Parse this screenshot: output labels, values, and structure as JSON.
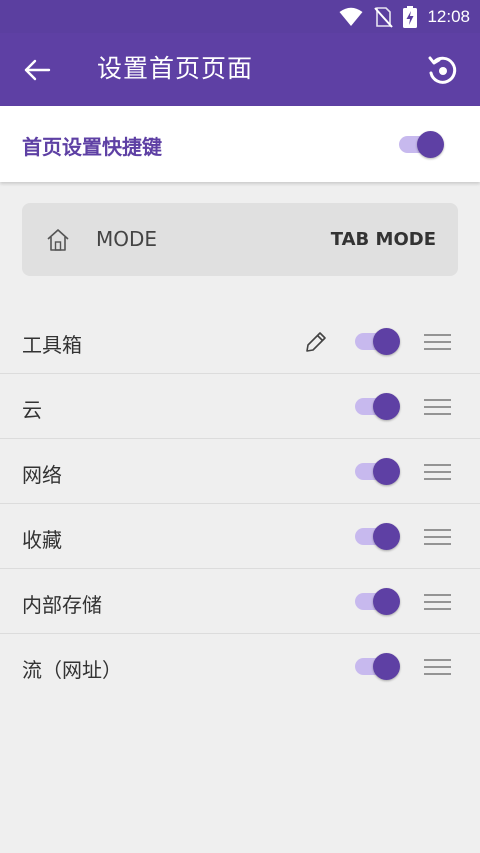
{
  "status_bar": {
    "time": "12:08",
    "icons": [
      "wifi-icon",
      "no-sim-icon",
      "battery-charging-icon"
    ]
  },
  "app_bar": {
    "title": "设置首页页面",
    "back_icon": "arrow-left-icon",
    "action_icon": "restore-icon"
  },
  "shortcut": {
    "label": "首页设置快捷键",
    "enabled": true
  },
  "mode": {
    "icon": "home-icon",
    "label": "MODE",
    "value": "TAB MODE"
  },
  "items": [
    {
      "label": "工具箱",
      "enabled": true,
      "editable": true
    },
    {
      "label": "云",
      "enabled": true,
      "editable": false
    },
    {
      "label": "网络",
      "enabled": true,
      "editable": false
    },
    {
      "label": "收藏",
      "enabled": true,
      "editable": false
    },
    {
      "label": "内部存储",
      "enabled": true,
      "editable": false
    },
    {
      "label": "流（网址）",
      "enabled": true,
      "editable": false
    }
  ],
  "colors": {
    "primary": "#5e40a4",
    "switch_track": "#c7b9ee",
    "background": "#efefef"
  }
}
